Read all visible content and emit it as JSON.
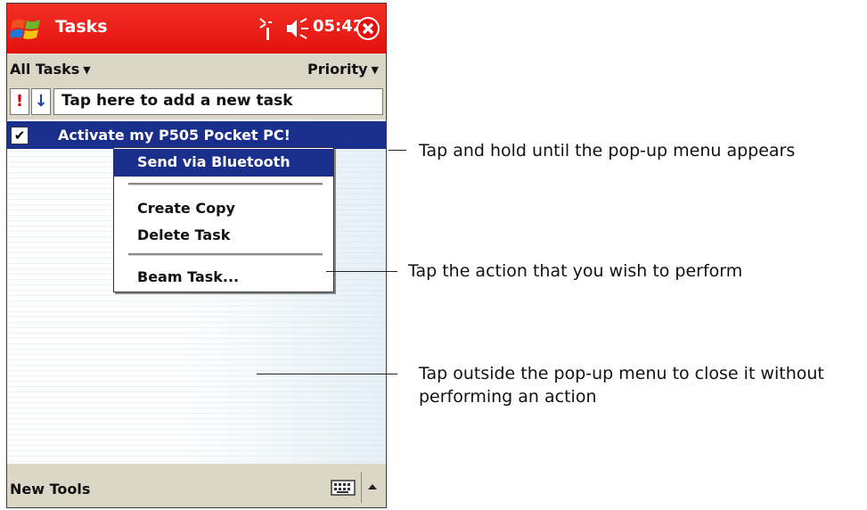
{
  "titlebar": {
    "app_title": "Tasks",
    "clock": "05:42"
  },
  "filterbar": {
    "filter": "All Tasks",
    "sort": "Priority"
  },
  "entrybar": {
    "priority_symbol": "!",
    "sort_symbol": "↓",
    "new_task_placeholder": "Tap here to add a new task"
  },
  "tasks": [
    {
      "title": "Activate my P505 Pocket PC!",
      "checked": true
    }
  ],
  "popup_menu": {
    "items": [
      {
        "label": "Send via Bluetooth",
        "highlighted": true
      },
      {
        "label": "Create Copy"
      },
      {
        "label": "Delete Task"
      },
      {
        "label": "Beam Task..."
      }
    ]
  },
  "menubar": {
    "label": "New Tools"
  },
  "callouts": [
    {
      "text": "Tap and hold until the pop-up menu appears"
    },
    {
      "text": "Tap the action that you wish to perform"
    },
    {
      "text": "Tap outside the pop-up menu to close it without performing an action"
    }
  ],
  "colors": {
    "titlebar": "#e2120c",
    "selection": "#1a2e8c",
    "bars": "#dcd6c7"
  },
  "icons": [
    "windows-start-icon",
    "signal-icon",
    "volume-icon",
    "close-icon",
    "keyboard-icon",
    "up-arrow-icon"
  ]
}
